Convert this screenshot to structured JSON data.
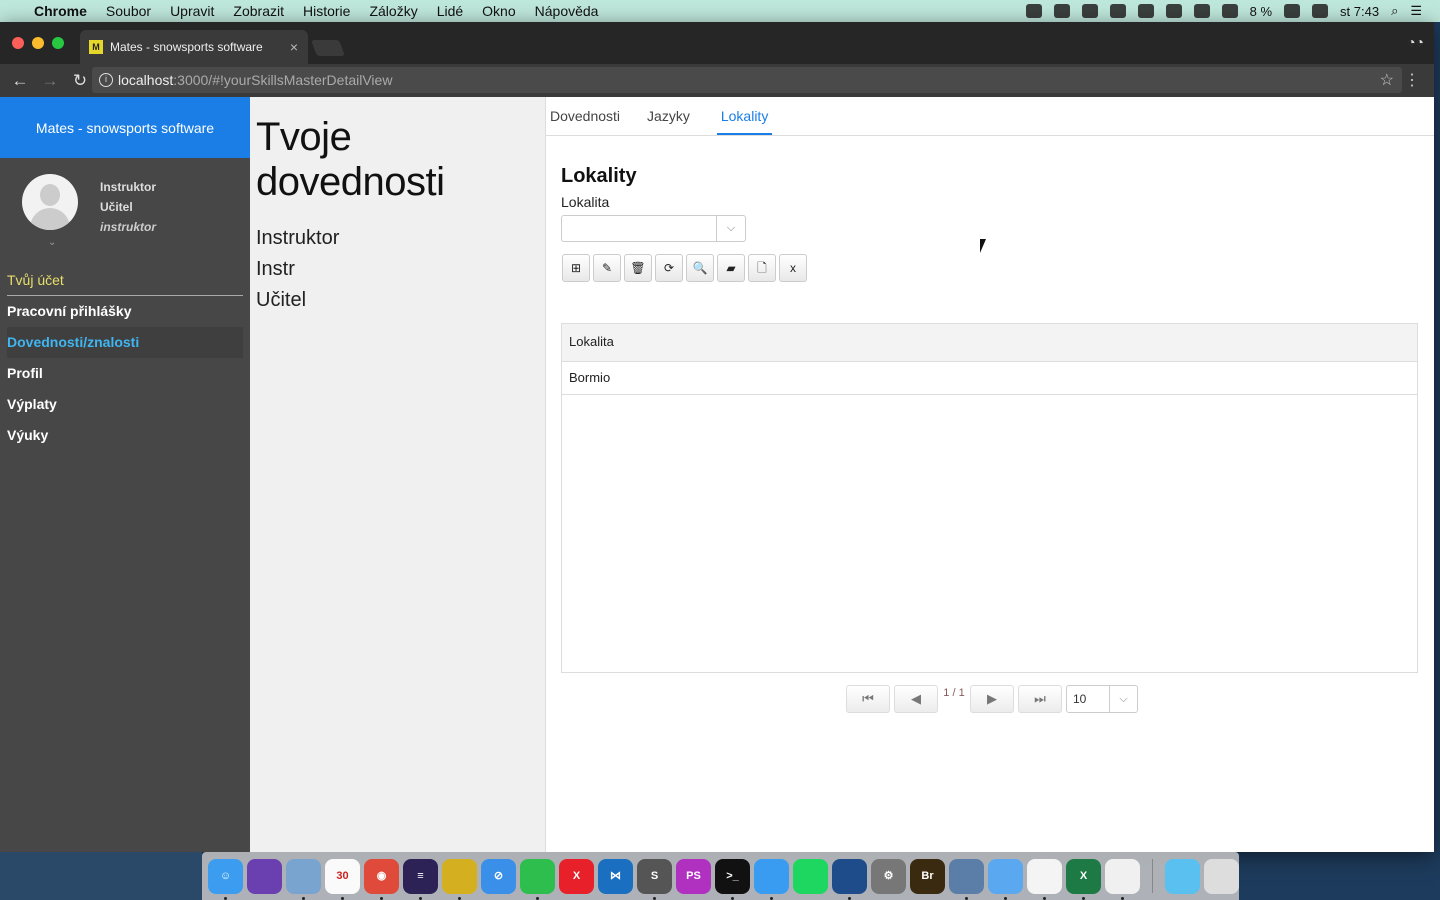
{
  "menubar": {
    "app": "Chrome",
    "items": [
      "Soubor",
      "Upravit",
      "Zobrazit",
      "Historie",
      "Záložky",
      "Lidé",
      "Okno",
      "Nápověda"
    ],
    "battery": "8 %",
    "clock": "st 7:43"
  },
  "browser": {
    "tab_title": "Mates - snowsports software",
    "favicon": "M",
    "url_host": "localhost",
    "url_rest": ":3000/#!yourSkillsMasterDetailView"
  },
  "sidebar": {
    "brand": "Mates - snowsports software",
    "user": {
      "line1": "Instruktor",
      "line2": "Učitel",
      "role": "instruktor"
    },
    "account": "Tvůj účet",
    "items": [
      {
        "label": "Pracovní přihlášky",
        "active": false
      },
      {
        "label": "Dovednosti/znalosti",
        "active": true
      },
      {
        "label": "Profil",
        "active": false
      },
      {
        "label": "Výplaty",
        "active": false
      },
      {
        "label": "Výuky",
        "active": false
      }
    ]
  },
  "middle": {
    "title": "Tvoje dovednosti",
    "lines": [
      "Instruktor",
      "Instr",
      "Učitel"
    ]
  },
  "main": {
    "tabs": [
      {
        "label": "Dovednosti",
        "active": false
      },
      {
        "label": "Jazyky",
        "active": false
      },
      {
        "label": "Lokality",
        "active": true
      }
    ],
    "heading": "Lokality",
    "field_label": "Lokalita",
    "field_value": "",
    "toolbar": [
      "add-icon",
      "edit-icon",
      "delete-icon",
      "refresh-icon",
      "search-icon",
      "eraser-icon",
      "file-icon",
      "excel-export-icon"
    ],
    "grid": {
      "columns": [
        "Lokalita"
      ],
      "rows": [
        [
          "Bormio"
        ]
      ]
    },
    "pager": {
      "info": "1 / 1",
      "page_size": "10"
    }
  },
  "colors": {
    "accent": "#1a7ee6",
    "sidebar": "#474747",
    "active_item": "#3fb6f2",
    "account": "#e8df6c"
  },
  "dock": [
    {
      "name": "Finder",
      "c": "#3b9cf0",
      "t": "☺",
      "r": true
    },
    {
      "name": "Siri",
      "c": "#6a3fb0",
      "t": "",
      "r": false
    },
    {
      "name": "Preview",
      "c": "#7aa4d0",
      "t": "",
      "r": true
    },
    {
      "name": "Calendar",
      "c": "#fafafa",
      "t": "30",
      "r": true
    },
    {
      "name": "Chrome",
      "c": "#e04a3a",
      "t": "◉",
      "r": true
    },
    {
      "name": "Eclipse",
      "c": "#2c2255",
      "t": "≡",
      "r": true
    },
    {
      "name": "ForkLift",
      "c": "#d4b020",
      "t": "",
      "r": true
    },
    {
      "name": "Safari",
      "c": "#3a90e8",
      "t": "⊘",
      "r": false
    },
    {
      "name": "Evernote",
      "c": "#2dbe4e",
      "t": "",
      "r": true
    },
    {
      "name": "XMind",
      "c": "#e8202a",
      "t": "X",
      "r": false
    },
    {
      "name": "VS Code",
      "c": "#1a6fc0",
      "t": "⋈",
      "r": false
    },
    {
      "name": "Sublime Text",
      "c": "#555",
      "t": "S",
      "r": true
    },
    {
      "name": "PhpStorm",
      "c": "#b030c0",
      "t": "PS",
      "r": false
    },
    {
      "name": "Terminal",
      "c": "#111",
      "t": ">_",
      "r": true
    },
    {
      "name": "TablePlus",
      "c": "#3a9cf0",
      "t": "",
      "r": true
    },
    {
      "name": "Spotify",
      "c": "#1ed760",
      "t": "",
      "r": false
    },
    {
      "name": "Sourcetree",
      "c": "#1e4c8a",
      "t": "",
      "r": true
    },
    {
      "name": "System Preferences",
      "c": "#777",
      "t": "⚙",
      "r": false
    },
    {
      "name": "Bridge",
      "c": "#3a2a10",
      "t": "Br",
      "r": false
    },
    {
      "name": "Postgres",
      "c": "#5a7ea8",
      "t": "",
      "r": true
    },
    {
      "name": "Lock",
      "c": "#5aa8f0",
      "t": "",
      "r": true
    },
    {
      "name": "Acrobat",
      "c": "#f4f4f4",
      "t": "",
      "r": true
    },
    {
      "name": "Excel",
      "c": "#1d7a45",
      "t": "X",
      "r": true
    },
    {
      "name": "Java",
      "c": "#f0f0f0",
      "t": "",
      "r": true
    },
    {
      "name": "Downloads",
      "c": "#5ac0f0",
      "t": "",
      "r": false
    },
    {
      "name": "Trash",
      "c": "#ddd",
      "t": "",
      "r": false
    }
  ]
}
